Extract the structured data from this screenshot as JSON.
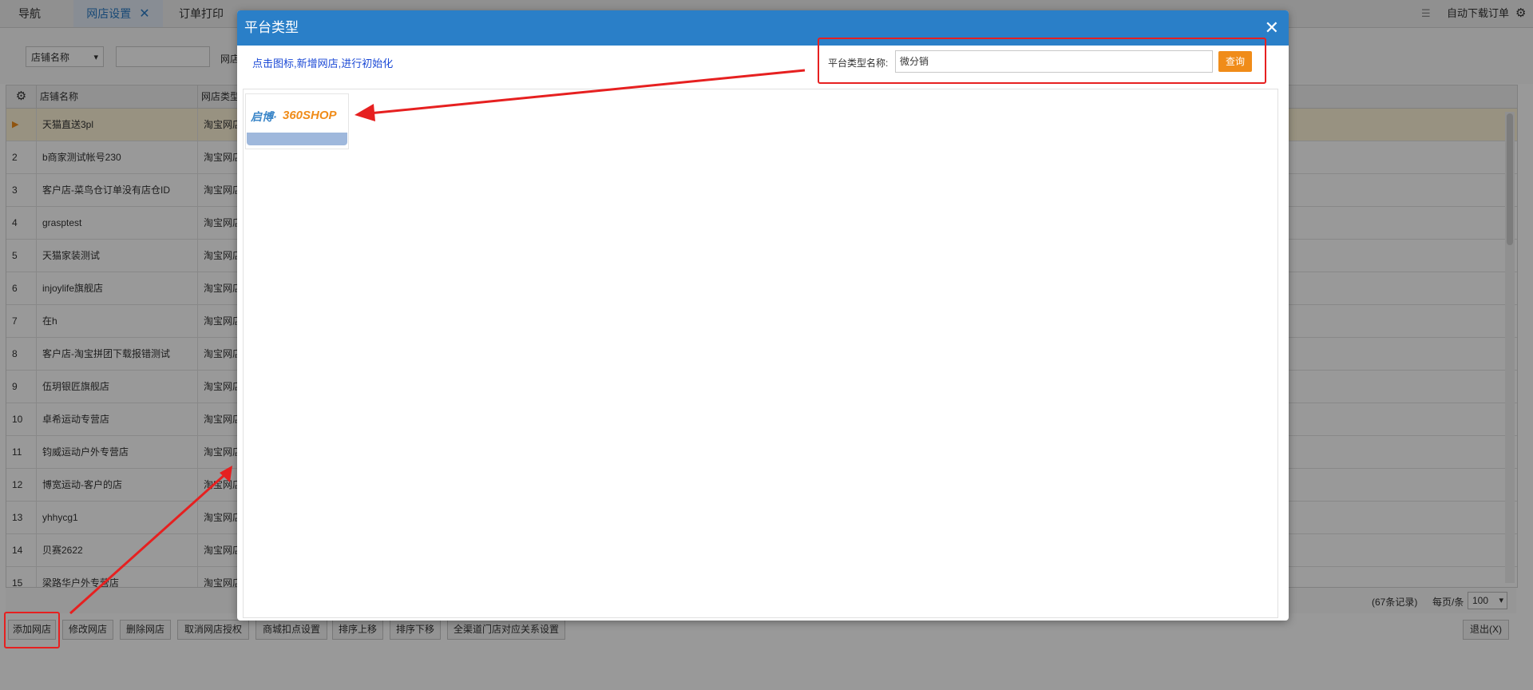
{
  "tabs": [
    {
      "label": "导航"
    },
    {
      "label": "网店设置",
      "close": "✕"
    },
    {
      "label": "订单打印"
    }
  ],
  "toolbar_right": {
    "auto_download_label": "自动下载订单"
  },
  "filter": {
    "select_value": "店铺名称",
    "label": "网店"
  },
  "grid": {
    "headers": [
      "店铺名称",
      "网店类型"
    ],
    "rows": [
      {
        "index": "▶",
        "name": "天猫直送3pl",
        "type": "淘宝网店"
      },
      {
        "index": "2",
        "name": "b商家测试帐号230",
        "type": "淘宝网店"
      },
      {
        "index": "3",
        "name": "客户店-菜鸟仓订单没有店仓ID",
        "type": "淘宝网店"
      },
      {
        "index": "4",
        "name": "grasptest",
        "type": "淘宝网店"
      },
      {
        "index": "5",
        "name": "天猫家装测试",
        "type": "淘宝网店"
      },
      {
        "index": "6",
        "name": "injoylife旗舰店",
        "type": "淘宝网店"
      },
      {
        "index": "7",
        "name": "在h",
        "type": "淘宝网店"
      },
      {
        "index": "8",
        "name": "客户店-淘宝拼团下载报错测试",
        "type": "淘宝网店"
      },
      {
        "index": "9",
        "name": "伍玥银匠旗舰店",
        "type": "淘宝网店"
      },
      {
        "index": "10",
        "name": "卓希运动专营店",
        "type": "淘宝网店"
      },
      {
        "index": "11",
        "name": "钧威运动户外专营店",
        "type": "淘宝网店"
      },
      {
        "index": "12",
        "name": "博宽运动-客户的店",
        "type": "淘宝网店"
      },
      {
        "index": "13",
        "name": "yhhycg1",
        "type": "淘宝网店"
      },
      {
        "index": "14",
        "name": "贝赛2622",
        "type": "淘宝网店"
      },
      {
        "index": "15",
        "name": "梁路华户外专营店",
        "type": "淘宝网店"
      }
    ]
  },
  "pagination": {
    "records": "(67条记录)",
    "per_page_label": "每页/条",
    "per_page_value": "100"
  },
  "buttons": {
    "add_shop": "添加网店",
    "edit_shop": "修改网店",
    "delete_shop": "删除网店",
    "cancel_auth": "取消网店授权",
    "mall_points": "商城扣点设置",
    "sort_up": "排序上移",
    "sort_down": "排序下移",
    "omni_channel": "全渠道门店对应关系设置",
    "exit": "退出(X)"
  },
  "dialog": {
    "title": "平台类型",
    "close": "✕",
    "hint": "点击图标,新增网店,进行初始化",
    "query_label": "平台类型名称:",
    "query_value": "微分销",
    "query_button": "查询",
    "platform_logo_text_a": "启博·",
    "platform_logo_text_b": "360SHOP"
  },
  "colors": {
    "dialog_header": "#2a7fc8",
    "query_button": "#f08c19",
    "annotation": "#e62020",
    "hint_text": "#1c4ad6"
  }
}
